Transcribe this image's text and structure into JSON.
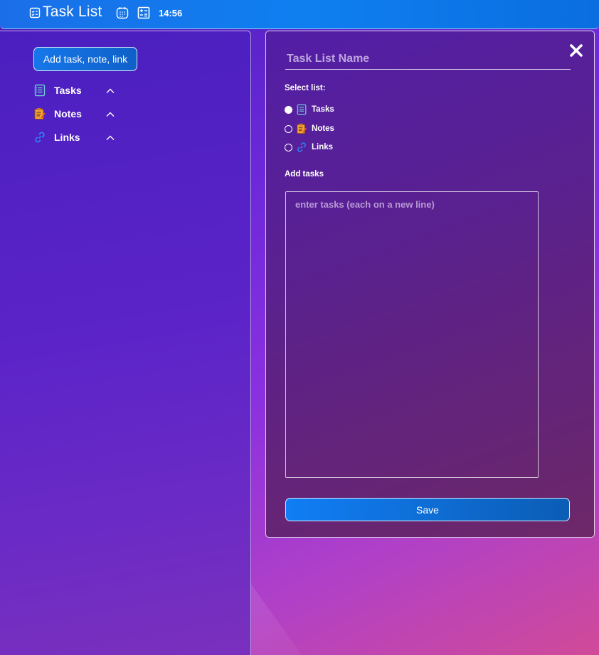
{
  "header": {
    "title": "Task List",
    "icon": "task-list-icon",
    "clock": "14:56",
    "colors": {
      "bar": "#0f7ff0"
    }
  },
  "sidebar": {
    "add_button_label": "Add task, note, link",
    "items": [
      {
        "label": "Tasks",
        "icon": "tasks-icon"
      },
      {
        "label": "Notes",
        "icon": "notes-icon"
      },
      {
        "label": "Links",
        "icon": "links-icon"
      }
    ]
  },
  "panel": {
    "name_placeholder": "Task List Name",
    "select_list_label": "Select list:",
    "list_options": [
      {
        "label": "Tasks",
        "selected": true
      },
      {
        "label": "Notes",
        "selected": false
      },
      {
        "label": "Links",
        "selected": false
      }
    ],
    "add_tasks_label": "Add tasks",
    "tasks_placeholder": "enter tasks (each on a new line)",
    "save_label": "Save"
  }
}
